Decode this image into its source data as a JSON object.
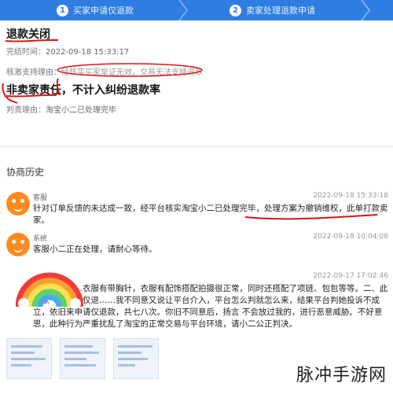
{
  "steps": [
    {
      "num": "1",
      "label": "买家申请仅退款"
    },
    {
      "num": "2",
      "label": "卖家处理退款申请"
    }
  ],
  "refund": {
    "status_title": "退款关闭",
    "time_label": "完结时间：",
    "time_value": "2022-09-18 15:33:17",
    "reason_label": "核激支持理由：",
    "reason_value": "经核实买家举证无效，交易无法支持退款",
    "responsibility": "非卖家责任，不计入纠纷退款率",
    "judge_label": "判责理由：",
    "judge_value": "淘宝小二已处理完毕"
  },
  "history": {
    "title": "协商历史",
    "messages": [
      {
        "sender": "客服",
        "time": "2022-09-18 15:33:18",
        "body": "针对订单反馈的未达成一致，经平台核实淘宝小二已处理完毕，处理方案为撤销维权，此单打款卖家。"
      },
      {
        "sender": "系统",
        "time": "2022-09-18 10:04:08",
        "body": "客服小二正在处理，请耐心等待。"
      },
      {
        "sender": "",
        "time": "2022-09-17 17:02:46",
        "body": "一、我们……衣服有带胸针，衣服有配饰搭配拍摄很正常，同时还搭配了项链、包包等等。二、此买家一直申请仅退……我不同意又说让平台介入，平台怎么判就怎么来，结果平台判她投诉不成立，依旧来申请仅退款，共七八次。你旧不同意后，扬言 不会放过我的，进行恶意威胁。不好意思，此种行为严重扰乱了淘宝的正常交易与平台环境，请小二公正判决。"
      }
    ]
  },
  "watermark": "脉冲手游网",
  "colors": {
    "steps_bar": "#2f7de1",
    "annotation_red": "#d71414",
    "avatar_orange": "#ff8a1f"
  }
}
